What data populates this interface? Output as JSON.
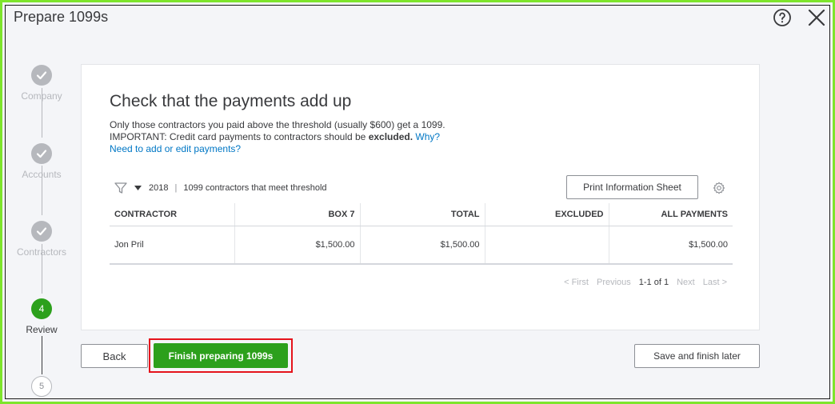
{
  "window": {
    "title": "Prepare 1099s",
    "help_icon": "help-circle-icon",
    "close_icon": "close-icon"
  },
  "stepper": {
    "steps": [
      {
        "label": "Company",
        "state": "done"
      },
      {
        "label": "Accounts",
        "state": "done"
      },
      {
        "label": "Contractors",
        "state": "done"
      },
      {
        "label": "Review",
        "state": "current",
        "number": "4"
      },
      {
        "label": "",
        "state": "future",
        "number": "5"
      }
    ]
  },
  "card": {
    "heading": "Check that the payments add up",
    "desc_line1": "Only those contractors you paid above the threshold (usually $600) get a 1099.",
    "desc_important_pre": "IMPORTANT: Credit card payments to contractors should be ",
    "desc_important_bold": "excluded.",
    "why_link": "Why?",
    "edit_link": "Need to add or edit payments?"
  },
  "filter": {
    "year": "2018",
    "description": "1099 contractors that meet threshold",
    "icon": "filter-icon"
  },
  "toolbar": {
    "print_label": "Print Information Sheet",
    "settings_icon": "gear-icon"
  },
  "table": {
    "headers": [
      "CONTRACTOR",
      "BOX 7",
      "TOTAL",
      "EXCLUDED",
      "ALL PAYMENTS"
    ],
    "rows": [
      [
        "Jon Pril",
        "$1,500.00",
        "$1,500.00",
        "",
        "$1,500.00"
      ]
    ]
  },
  "pagination": {
    "first": "< First",
    "previous": "Previous",
    "count": "1-1 of 1",
    "next": "Next",
    "last": "Last >"
  },
  "footer": {
    "back_label": "Back",
    "finish_label": "Finish preparing 1099s",
    "save_label": "Save and finish later"
  },
  "colors": {
    "accent_green": "#2ca01c",
    "highlight_red": "#e5131c",
    "frame_green": "#7ee52c",
    "link_blue": "#0077c5"
  }
}
